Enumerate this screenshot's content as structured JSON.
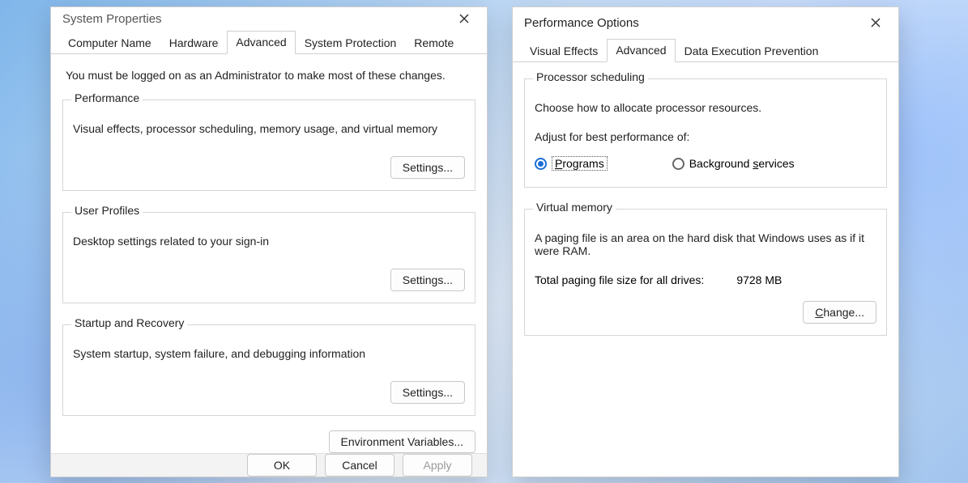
{
  "left": {
    "title": "System Properties",
    "tabs": [
      "Computer Name",
      "Hardware",
      "Advanced",
      "System Protection",
      "Remote"
    ],
    "active_tab": "Advanced",
    "admin_note": "You must be logged on as an Administrator to make most of these changes.",
    "performance": {
      "legend": "Performance",
      "desc": "Visual effects, processor scheduling, memory usage, and virtual memory",
      "settings": "Settings..."
    },
    "user_profiles": {
      "legend": "User Profiles",
      "desc": "Desktop settings related to your sign-in",
      "settings": "Settings..."
    },
    "startup": {
      "legend": "Startup and Recovery",
      "desc": "System startup, system failure, and debugging information",
      "settings": "Settings..."
    },
    "env_button": "Environment Variables...",
    "footer": {
      "ok": "OK",
      "cancel": "Cancel",
      "apply": "Apply"
    }
  },
  "right": {
    "title": "Performance Options",
    "tabs": [
      "Visual Effects",
      "Advanced",
      "Data Execution Prevention"
    ],
    "active_tab": "Advanced",
    "processor": {
      "legend": "Processor scheduling",
      "desc": "Choose how to allocate processor resources.",
      "adjust": "Adjust for best performance of:",
      "programs": "Programs",
      "background": "Background services",
      "selected": "programs"
    },
    "vm": {
      "legend": "Virtual memory",
      "desc": "A paging file is an area on the hard disk that Windows uses as if it were RAM.",
      "total_label": "Total paging file size for all drives:",
      "total_value": "9728 MB",
      "change": "Change..."
    }
  }
}
